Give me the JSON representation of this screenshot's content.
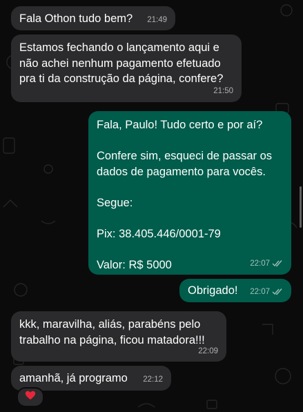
{
  "colors": {
    "background": "#0b0b0b",
    "incoming_bubble": "#2b2b2d",
    "outgoing_bubble": "#005c4b",
    "text": "#ffffff",
    "timestamp": "#a0a0a0"
  },
  "messages": [
    {
      "direction": "incoming",
      "text": "Fala Othon tudo bem?",
      "time": "21:49"
    },
    {
      "direction": "incoming",
      "text": "Estamos fechando o lançamento aqui e não achei nenhum pagamento efetuado pra ti da construção da página, confere?",
      "time": "21:50"
    },
    {
      "direction": "outgoing",
      "text": "Fala, Paulo! Tudo certo e por aí?\n\nConfere sim, esqueci de passar os dados de pagamento para vocês.\n\nSegue:\n\nPix: 38.405.446/0001-79\n\nValor: R$ 5000",
      "time": "22:07",
      "status_icon": "double-check-icon"
    },
    {
      "direction": "outgoing",
      "text": "Obrigado!",
      "time": "22:07",
      "status_icon": "double-check-icon"
    },
    {
      "direction": "incoming",
      "text": "kkk, maravilha, aliás, parabéns pelo trabalho na página, ficou matadora!!!",
      "time": "22:09"
    },
    {
      "direction": "incoming",
      "text": "amanhã, já programo",
      "time": "22:12",
      "reaction": "red-heart-icon"
    }
  ]
}
